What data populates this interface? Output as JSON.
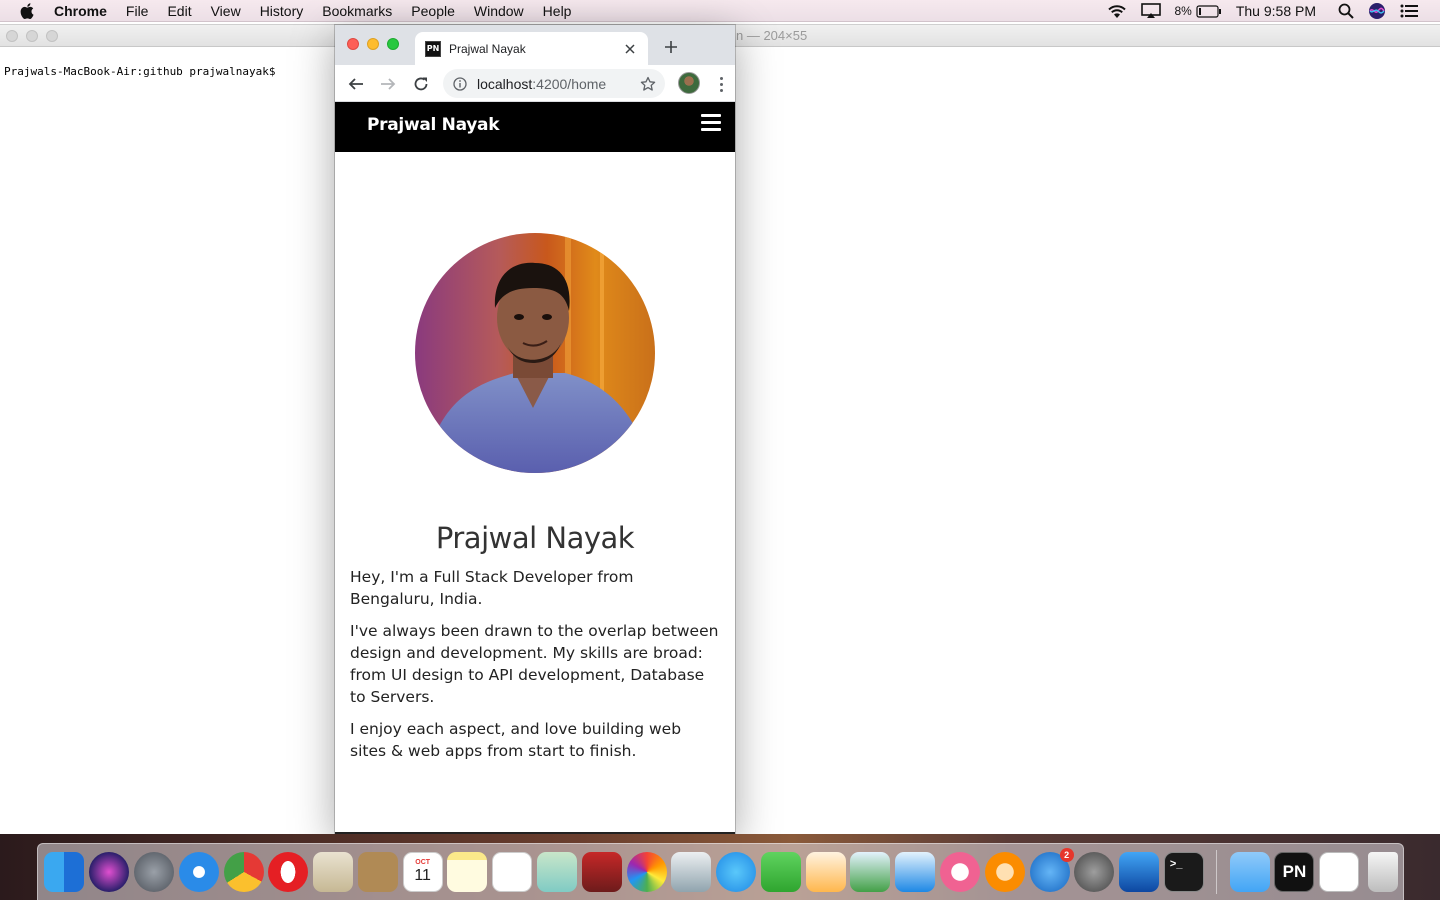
{
  "menubar": {
    "app_name": "Chrome",
    "items": [
      "File",
      "Edit",
      "View",
      "History",
      "Bookmarks",
      "People",
      "Window",
      "Help"
    ],
    "battery": "8%",
    "clock": "Thu 9:58 PM"
  },
  "terminal": {
    "title_fragment": "n — 204×55",
    "prompt": "Prajwals-MacBook-Air:github prajwalnayak$"
  },
  "chrome": {
    "tab_title": "Prajwal Nayak",
    "favicon_text": "PN",
    "url_host": "localhost",
    "url_rest": ":4200/home"
  },
  "page": {
    "brand": "Prajwal Nayak",
    "name": "Prajwal Nayak",
    "bio": [
      "Hey, I'm a Full Stack Developer from Bengaluru, India.",
      "I've always been drawn to the overlap between design and development. My skills are broad: from UI design to API development, Database to Servers.",
      "I enjoy each aspect, and love building web sites & web apps from start to finish."
    ]
  },
  "dock": {
    "calendar_month": "OCT",
    "calendar_day": "11",
    "app_store_badge": "2",
    "pn_label": "PN"
  }
}
